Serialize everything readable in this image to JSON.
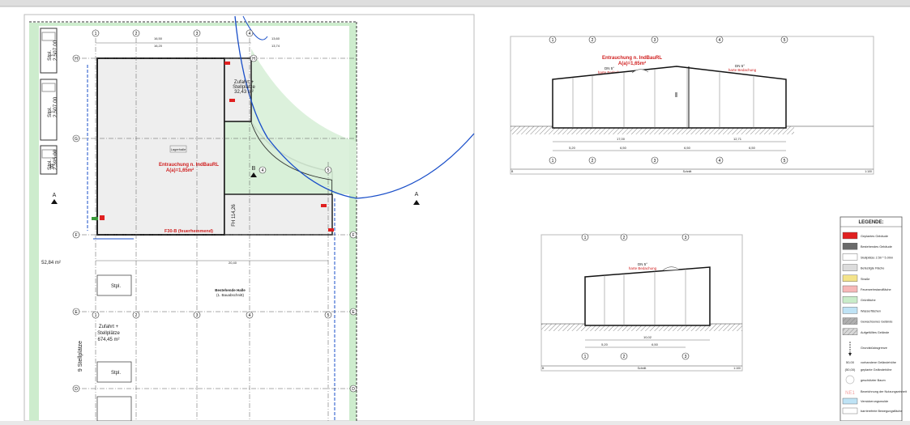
{
  "site_plan": {
    "parking_labels": [
      "Stpl.\n2,507.00",
      "Stpl.\n2,507.00",
      "Stpl.\n2,595.00"
    ],
    "parking_lot_1": "Stpl.",
    "parking_lot_2": "Stpl.",
    "smoke_vent_title": "Entrauchung n. IndBauRL",
    "smoke_vent_area": "A(a)=1,65m²",
    "access_title": "Zufahrt +",
    "access_sub": "Stellplätze",
    "access_area": "32,43 m²",
    "access2_title": "Zufahrt +",
    "access2_sub": "Stellplätze",
    "access2_area": "674,45 m²",
    "fire_wall": "F30-B (feuerhemmend)",
    "existing_hall": "Bestehende Halle",
    "existing_hall_sub": "(1. Bauabschnitt)",
    "area_green": "52,84 m²",
    "nine_parking": "9 Stellplätze",
    "fh_label": "FH 114,26",
    "section_a": "A",
    "section_b": "B",
    "grid_cols": [
      "1",
      "2",
      "3",
      "4"
    ],
    "grid_col_5": "5",
    "grid_rows": [
      "H",
      "G",
      "F",
      "E",
      "D"
    ],
    "dims_top": [
      "16,50",
      "16,20",
      "13,60",
      "13,74"
    ],
    "dim_bottom": "20,40",
    "lager_label": "Lagerhalle"
  },
  "section_1": {
    "title": "Entrauchung n. IndBauRL",
    "area": "A(a)=1,65m²",
    "roof_left": "DN 5°",
    "roof_left_sub": "harte Bedachung",
    "roof_right": "DN 5°",
    "roof_right_sub": "harte Bedachung",
    "axes": [
      "1",
      "2",
      "3",
      "4",
      "5"
    ],
    "dims": [
      "5,20",
      "6,50",
      "6,50",
      "6,50"
    ],
    "total": "17,00",
    "total_right": "12,71",
    "footer_left": "B",
    "footer_mid": "Schnitt",
    "footer_right": "1:100"
  },
  "section_2": {
    "roof": "DN 5°",
    "roof_sub": "harte Bedachung",
    "axes": [
      "1",
      "2",
      "3"
    ],
    "dims": [
      "5,20",
      "6,50"
    ],
    "total": "10,02",
    "footer_left": "B",
    "footer_mid": "Schnitt",
    "footer_right": "1:100"
  },
  "legend": {
    "title": "LEGENDE:",
    "items": [
      {
        "label": "Geplantes Gebäude",
        "color": "#e02020"
      },
      {
        "label": "Bestehendes Gebäude",
        "color": "#6a6a6a"
      },
      {
        "label": "Stellplätze 2.50 * 5.00m",
        "color": "#ffffff"
      },
      {
        "label": "Befestigte Fläche",
        "color": "#dcdcdc"
      },
      {
        "label": "Straße",
        "color": "#f3e38a"
      },
      {
        "label": "Feuerwehrstandfläche",
        "color": "#f6b8b8"
      },
      {
        "label": "Grünfläche",
        "color": "#c9ecc9"
      },
      {
        "label": "Wasserflächen",
        "color": "#bfe3f5"
      },
      {
        "label": "Gewachsenes Gelände",
        "color": "#b0b0b0"
      },
      {
        "label": "Aufgefülltes Gelände",
        "color": "#d8d8d8"
      }
    ],
    "boundary": "Grundstücksgrenze",
    "elev_1_val": "50,00",
    "elev_1": "vorhandene Geländehöhe",
    "elev_2_val": "(50,00)",
    "elev_2": "geplante Geländehöhe",
    "tree": "geschützter Baum",
    "ne_symbol": "NE1",
    "ne_label": "Bezeichnung der Nutzungseinheit",
    "sealing": "Versickerungsmulde",
    "barrier_free": "barrierefreie Bewegungsfläche"
  }
}
